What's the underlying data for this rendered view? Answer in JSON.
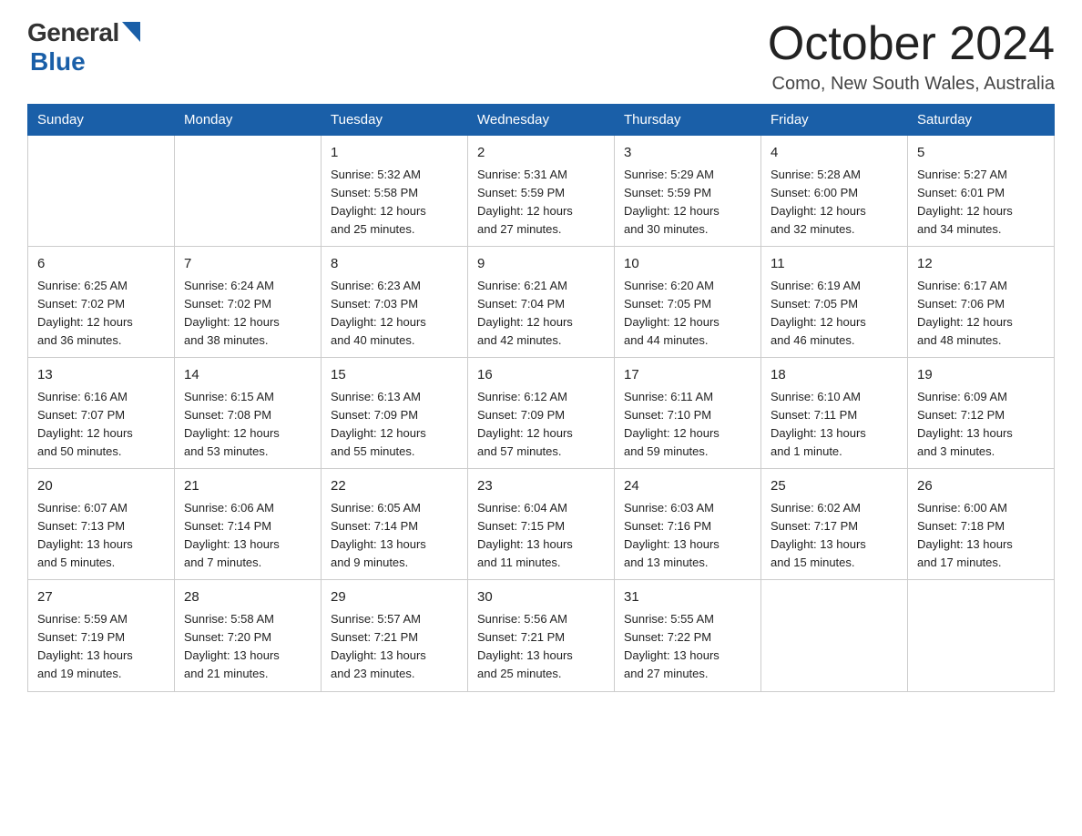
{
  "header": {
    "title": "October 2024",
    "location": "Como, New South Wales, Australia",
    "logo_general": "General",
    "logo_blue": "Blue"
  },
  "calendar": {
    "days_of_week": [
      "Sunday",
      "Monday",
      "Tuesday",
      "Wednesday",
      "Thursday",
      "Friday",
      "Saturday"
    ],
    "weeks": [
      [
        {
          "day": "",
          "info": ""
        },
        {
          "day": "",
          "info": ""
        },
        {
          "day": "1",
          "info": "Sunrise: 5:32 AM\nSunset: 5:58 PM\nDaylight: 12 hours\nand 25 minutes."
        },
        {
          "day": "2",
          "info": "Sunrise: 5:31 AM\nSunset: 5:59 PM\nDaylight: 12 hours\nand 27 minutes."
        },
        {
          "day": "3",
          "info": "Sunrise: 5:29 AM\nSunset: 5:59 PM\nDaylight: 12 hours\nand 30 minutes."
        },
        {
          "day": "4",
          "info": "Sunrise: 5:28 AM\nSunset: 6:00 PM\nDaylight: 12 hours\nand 32 minutes."
        },
        {
          "day": "5",
          "info": "Sunrise: 5:27 AM\nSunset: 6:01 PM\nDaylight: 12 hours\nand 34 minutes."
        }
      ],
      [
        {
          "day": "6",
          "info": "Sunrise: 6:25 AM\nSunset: 7:02 PM\nDaylight: 12 hours\nand 36 minutes."
        },
        {
          "day": "7",
          "info": "Sunrise: 6:24 AM\nSunset: 7:02 PM\nDaylight: 12 hours\nand 38 minutes."
        },
        {
          "day": "8",
          "info": "Sunrise: 6:23 AM\nSunset: 7:03 PM\nDaylight: 12 hours\nand 40 minutes."
        },
        {
          "day": "9",
          "info": "Sunrise: 6:21 AM\nSunset: 7:04 PM\nDaylight: 12 hours\nand 42 minutes."
        },
        {
          "day": "10",
          "info": "Sunrise: 6:20 AM\nSunset: 7:05 PM\nDaylight: 12 hours\nand 44 minutes."
        },
        {
          "day": "11",
          "info": "Sunrise: 6:19 AM\nSunset: 7:05 PM\nDaylight: 12 hours\nand 46 minutes."
        },
        {
          "day": "12",
          "info": "Sunrise: 6:17 AM\nSunset: 7:06 PM\nDaylight: 12 hours\nand 48 minutes."
        }
      ],
      [
        {
          "day": "13",
          "info": "Sunrise: 6:16 AM\nSunset: 7:07 PM\nDaylight: 12 hours\nand 50 minutes."
        },
        {
          "day": "14",
          "info": "Sunrise: 6:15 AM\nSunset: 7:08 PM\nDaylight: 12 hours\nand 53 minutes."
        },
        {
          "day": "15",
          "info": "Sunrise: 6:13 AM\nSunset: 7:09 PM\nDaylight: 12 hours\nand 55 minutes."
        },
        {
          "day": "16",
          "info": "Sunrise: 6:12 AM\nSunset: 7:09 PM\nDaylight: 12 hours\nand 57 minutes."
        },
        {
          "day": "17",
          "info": "Sunrise: 6:11 AM\nSunset: 7:10 PM\nDaylight: 12 hours\nand 59 minutes."
        },
        {
          "day": "18",
          "info": "Sunrise: 6:10 AM\nSunset: 7:11 PM\nDaylight: 13 hours\nand 1 minute."
        },
        {
          "day": "19",
          "info": "Sunrise: 6:09 AM\nSunset: 7:12 PM\nDaylight: 13 hours\nand 3 minutes."
        }
      ],
      [
        {
          "day": "20",
          "info": "Sunrise: 6:07 AM\nSunset: 7:13 PM\nDaylight: 13 hours\nand 5 minutes."
        },
        {
          "day": "21",
          "info": "Sunrise: 6:06 AM\nSunset: 7:14 PM\nDaylight: 13 hours\nand 7 minutes."
        },
        {
          "day": "22",
          "info": "Sunrise: 6:05 AM\nSunset: 7:14 PM\nDaylight: 13 hours\nand 9 minutes."
        },
        {
          "day": "23",
          "info": "Sunrise: 6:04 AM\nSunset: 7:15 PM\nDaylight: 13 hours\nand 11 minutes."
        },
        {
          "day": "24",
          "info": "Sunrise: 6:03 AM\nSunset: 7:16 PM\nDaylight: 13 hours\nand 13 minutes."
        },
        {
          "day": "25",
          "info": "Sunrise: 6:02 AM\nSunset: 7:17 PM\nDaylight: 13 hours\nand 15 minutes."
        },
        {
          "day": "26",
          "info": "Sunrise: 6:00 AM\nSunset: 7:18 PM\nDaylight: 13 hours\nand 17 minutes."
        }
      ],
      [
        {
          "day": "27",
          "info": "Sunrise: 5:59 AM\nSunset: 7:19 PM\nDaylight: 13 hours\nand 19 minutes."
        },
        {
          "day": "28",
          "info": "Sunrise: 5:58 AM\nSunset: 7:20 PM\nDaylight: 13 hours\nand 21 minutes."
        },
        {
          "day": "29",
          "info": "Sunrise: 5:57 AM\nSunset: 7:21 PM\nDaylight: 13 hours\nand 23 minutes."
        },
        {
          "day": "30",
          "info": "Sunrise: 5:56 AM\nSunset: 7:21 PM\nDaylight: 13 hours\nand 25 minutes."
        },
        {
          "day": "31",
          "info": "Sunrise: 5:55 AM\nSunset: 7:22 PM\nDaylight: 13 hours\nand 27 minutes."
        },
        {
          "day": "",
          "info": ""
        },
        {
          "day": "",
          "info": ""
        }
      ]
    ]
  }
}
